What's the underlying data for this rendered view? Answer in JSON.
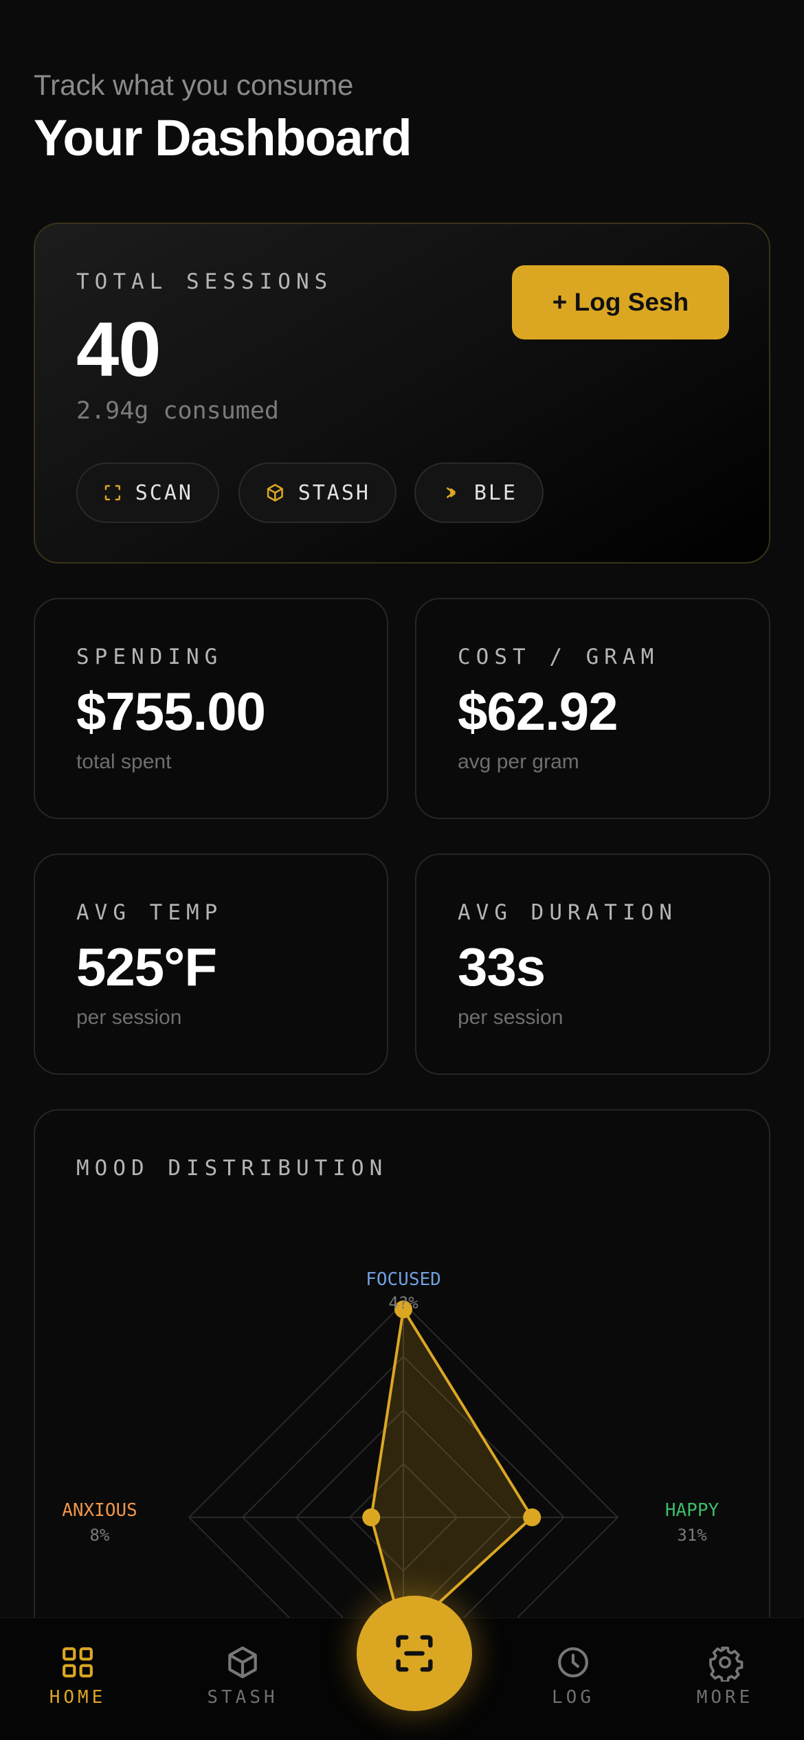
{
  "header": {
    "subtitle": "Track what you consume",
    "title": "Your Dashboard"
  },
  "hero": {
    "label": "TOTAL SESSIONS",
    "value": "40",
    "sub": "2.94g consumed",
    "log_button": "+ Log Sesh",
    "chips": [
      {
        "label": "SCAN",
        "icon": "scan-icon"
      },
      {
        "label": "STASH",
        "icon": "box-icon"
      },
      {
        "label": "BLE",
        "icon": "bluetooth-icon"
      }
    ]
  },
  "stats": [
    {
      "label": "SPENDING",
      "value": "$755.00",
      "sub": "total spent"
    },
    {
      "label": "COST / GRAM",
      "value": "$62.92",
      "sub": "avg per gram"
    },
    {
      "label": "AVG TEMP",
      "value": "525°F",
      "sub": "per session"
    },
    {
      "label": "AVG DURATION",
      "value": "33s",
      "sub": "per session"
    }
  ],
  "mood": {
    "label": "MOOD DISTRIBUTION"
  },
  "chart_data": {
    "type": "radar",
    "axes": [
      {
        "name": "FOCUSED",
        "percent_label": "4?%",
        "value": 0.97,
        "color": "#6fa0e0"
      },
      {
        "name": "HAPPY",
        "percent_label": "31%",
        "value": 0.6,
        "color": "#3dbb6b"
      },
      {
        "name": "",
        "percent_label": "",
        "value": 0.55,
        "color": "#888888"
      },
      {
        "name": "ANXIOUS",
        "percent_label": "8%",
        "value": 0.15,
        "color": "#f0954a"
      }
    ],
    "rings": 4,
    "fill_color": "#dba723"
  },
  "nav": {
    "items": [
      {
        "label": "HOME",
        "icon": "grid-icon",
        "active": true
      },
      {
        "label": "STASH",
        "icon": "box-icon",
        "active": false
      },
      {
        "label": "LOG",
        "icon": "clock-icon",
        "active": false
      },
      {
        "label": "MORE",
        "icon": "gear-icon",
        "active": false
      }
    ],
    "fab_icon": "scan-icon"
  },
  "colors": {
    "accent": "#dba723",
    "background": "#0b0b0b"
  }
}
